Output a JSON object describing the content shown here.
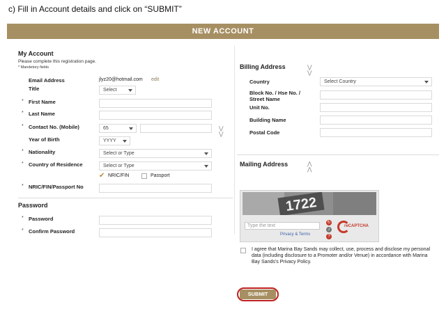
{
  "instruction": "c) Fill in Account details and click on “SUBMIT”",
  "banner": "NEW ACCOUNT",
  "account": {
    "heading": "My Account",
    "subtext": "Please complete this registration page.",
    "mandatory": "* Mandetory fields",
    "email_label": "Email Address",
    "email_value": "jlyz20@hotmail.com",
    "edit_link": "edit",
    "title_label": "Title",
    "title_value": "Select",
    "first_name_label": "First Name",
    "last_name_label": "Last Name",
    "contact_label": "Contact No. (Mobile)",
    "contact_code": "65",
    "yob_label": "Year of Birth",
    "yob_value": "YYYY",
    "nationality_label": "Nationality",
    "nationality_value": "Select or Type",
    "residence_label": "Country of Residence",
    "residence_value": "Select or Type",
    "nric_option": "NRIC/FIN",
    "passport_option": "Passport",
    "nric_label": "NRIC/FIN/Passport No",
    "star": "*"
  },
  "password": {
    "heading": "Password",
    "password_label": "Password",
    "confirm_label": "Confirm Password"
  },
  "billing": {
    "heading": "Billing Address",
    "country_label": "Country",
    "country_value": "Select Country",
    "block_label_1": "Block No. / Hse No. /",
    "block_label_2": "Street Name",
    "unit_label": "Unit No.",
    "building_label": "Building Name",
    "postal_label": "Postal Code"
  },
  "mailing": {
    "heading": "Mailing Address"
  },
  "captcha": {
    "code": "1722",
    "placeholder": "Type the text",
    "privacy": "Privacy & Terms",
    "brand": "reCAPTCHA"
  },
  "agreement": "I agree that Marina Bay Sands may collect, use, process and disclose my personal data (including disclosure to a Promoter and/or Venue) in accordance with Marina Bay Sands's Privacy Policy.",
  "submit_label": "SUBMIT",
  "colors": {
    "brand": "#a68f62",
    "highlight": "#c02020"
  }
}
